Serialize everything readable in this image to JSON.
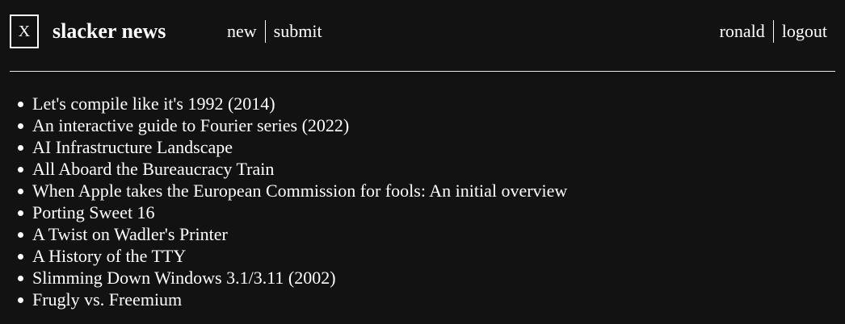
{
  "header": {
    "logo_letter": "X",
    "site_title": "slacker news",
    "nav_left": [
      {
        "label": "new"
      },
      {
        "label": "submit"
      }
    ],
    "nav_right": [
      {
        "label": "ronald"
      },
      {
        "label": "logout"
      }
    ]
  },
  "stories": [
    {
      "title": "Let's compile like it's 1992 (2014)"
    },
    {
      "title": "An interactive guide to Fourier series (2022)"
    },
    {
      "title": "AI Infrastructure Landscape"
    },
    {
      "title": "All Aboard the Bureaucracy Train"
    },
    {
      "title": "When Apple takes the European Commission for fools: An initial overview"
    },
    {
      "title": "Porting Sweet 16"
    },
    {
      "title": "A Twist on Wadler's Printer"
    },
    {
      "title": "A History of the TTY"
    },
    {
      "title": "Slimming Down Windows 3.1/3.11 (2002)"
    },
    {
      "title": "Frugly vs. Freemium"
    }
  ]
}
